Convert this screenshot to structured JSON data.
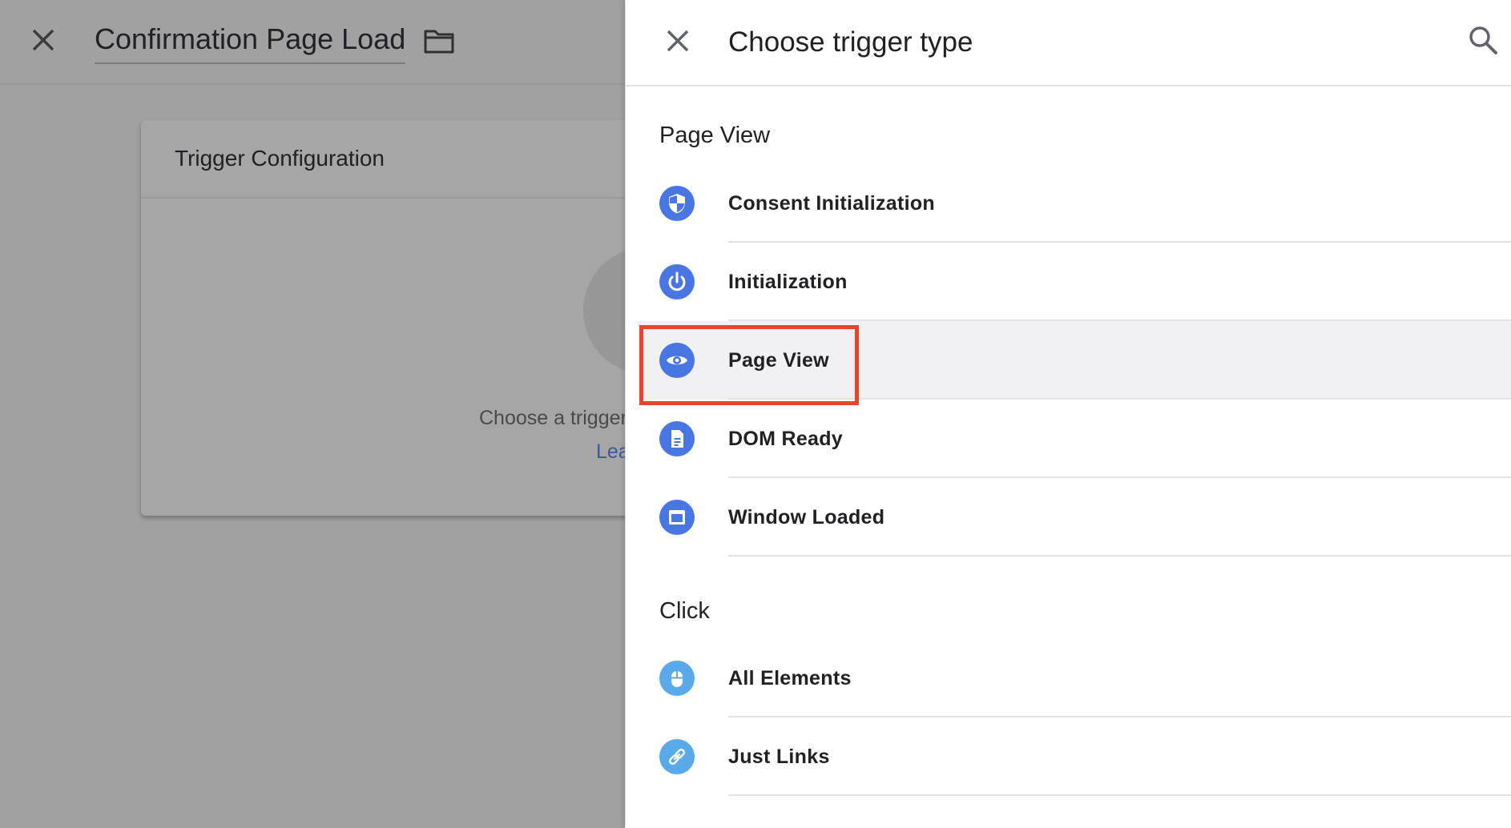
{
  "background": {
    "title": "Confirmation Page Load",
    "card": {
      "title": "Trigger Configuration",
      "hint": "Choose a trigger",
      "link": "Lea"
    }
  },
  "panel": {
    "title": "Choose trigger type",
    "sections": [
      {
        "title": "Page View",
        "items": [
          {
            "label": "Consent Initialization",
            "icon": "shield-icon"
          },
          {
            "label": "Initialization",
            "icon": "power-icon"
          },
          {
            "label": "Page View",
            "icon": "eye-icon"
          },
          {
            "label": "DOM Ready",
            "icon": "document-icon"
          },
          {
            "label": "Window Loaded",
            "icon": "window-icon"
          }
        ]
      },
      {
        "title": "Click",
        "items": [
          {
            "label": "All Elements",
            "icon": "mouse-icon"
          },
          {
            "label": "Just Links",
            "icon": "link-icon"
          }
        ]
      }
    ]
  },
  "colors": {
    "icon_blue": "#4a76e3",
    "icon_light_blue": "#5aaae9",
    "highlight_red": "#e8452b",
    "selected_row": "#f1f1f3",
    "overlay_gray": "#a1a1a2"
  }
}
